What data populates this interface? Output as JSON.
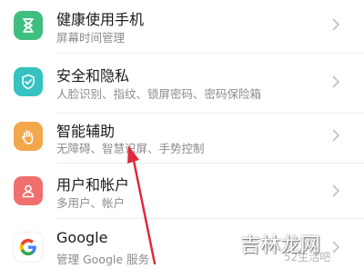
{
  "settings_list": {
    "items": [
      {
        "title": "健康使用手机",
        "subtitle": "屏幕时间管理",
        "icon": "hourglass-icon",
        "icon_color": "#3fbf7f"
      },
      {
        "title": "安全和隐私",
        "subtitle": "人脸识别、指纹、锁屏密码、密码保险箱",
        "icon": "shield-check-icon",
        "icon_color": "#35c2c0"
      },
      {
        "title": "智能辅助",
        "subtitle": "无障碍、智慧识屏、手势控制",
        "icon": "hand-icon",
        "icon_color": "#f2a74a"
      },
      {
        "title": "用户和帐户",
        "subtitle": "多用户、帐户",
        "icon": "user-icon",
        "icon_color": "#f07070"
      },
      {
        "title": "Google",
        "subtitle": "管理 Google 服务",
        "icon": "google-icon",
        "icon_color": "#ffffff"
      }
    ]
  },
  "annotation": {
    "color": "#e02b3a"
  },
  "watermark": {
    "text": "吉林龙网",
    "sub_text": "52生活吧"
  }
}
